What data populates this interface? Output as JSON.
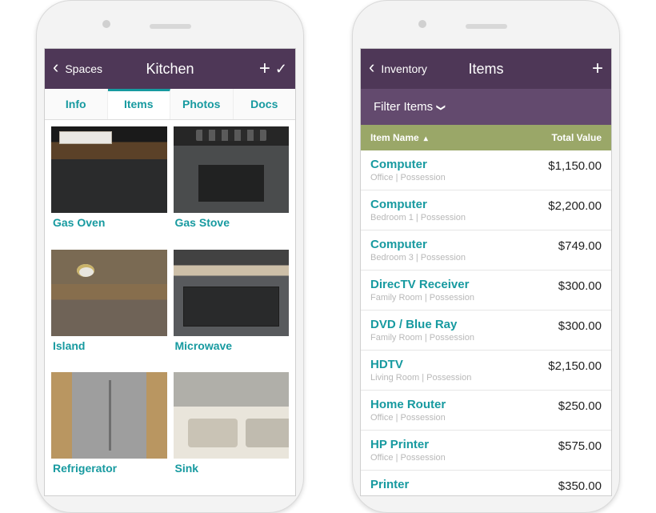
{
  "left_phone": {
    "header": {
      "back": "Spaces",
      "title": "Kitchen"
    },
    "tabs": [
      "Info",
      "Items",
      "Photos",
      "Docs"
    ],
    "active_tab_index": 1,
    "items": [
      {
        "label": "Gas Oven",
        "thumb": "t-oven"
      },
      {
        "label": "Gas Stove",
        "thumb": "t-stove"
      },
      {
        "label": "Island",
        "thumb": "t-island"
      },
      {
        "label": "Microwave",
        "thumb": "t-micro"
      },
      {
        "label": "Refrigerator",
        "thumb": "t-fridge"
      },
      {
        "label": "Sink",
        "thumb": "t-sink"
      }
    ]
  },
  "right_phone": {
    "header": {
      "back": "Inventory",
      "title": "Items"
    },
    "filter_label": "Filter Items",
    "columns": {
      "name": "Item Name",
      "value": "Total Value"
    },
    "rows": [
      {
        "name": "Computer",
        "sub": "Office | Possession",
        "value": "$1,150.00"
      },
      {
        "name": "Computer",
        "sub": "Bedroom 1 | Possession",
        "value": "$2,200.00"
      },
      {
        "name": "Computer",
        "sub": "Bedroom 3 | Possession",
        "value": "$749.00"
      },
      {
        "name": "DirecTV Receiver",
        "sub": "Family Room | Possession",
        "value": "$300.00"
      },
      {
        "name": "DVD / Blue Ray",
        "sub": "Family Room | Possession",
        "value": "$300.00"
      },
      {
        "name": "HDTV",
        "sub": "Living Room | Possession",
        "value": "$2,150.00"
      },
      {
        "name": "Home Router",
        "sub": "Office | Possession",
        "value": "$250.00"
      },
      {
        "name": "HP Printer",
        "sub": "Office | Possession",
        "value": "$575.00"
      },
      {
        "name": "Printer",
        "sub": "",
        "value": "$350.00"
      }
    ]
  }
}
